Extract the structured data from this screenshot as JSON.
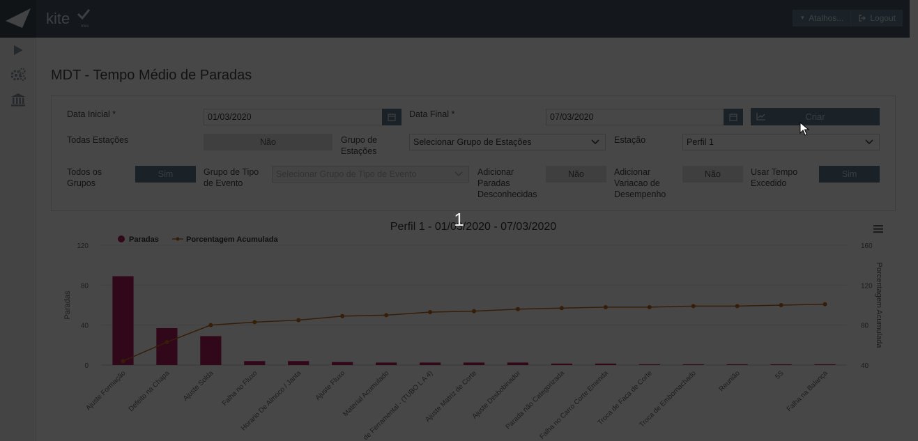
{
  "header": {
    "brand": "kite",
    "brand_sub": "mes",
    "shortcuts_label": "Atalhos...",
    "logout_label": "Logout"
  },
  "sidebar": {
    "items": [
      {
        "icon": "play-icon"
      },
      {
        "icon": "gears-icon"
      },
      {
        "icon": "bank-icon"
      }
    ]
  },
  "page": {
    "title": "MDT - Tempo Médio de Paradas"
  },
  "form": {
    "data_inicial_label": "Data Inicial *",
    "data_inicial_value": "01/03/2020",
    "data_final_label": "Data Final *",
    "data_final_value": "07/03/2020",
    "criar_label": "Criar",
    "todas_estacoes_label": "Todas Estações",
    "todas_estacoes_value": "Não",
    "grupo_estacoes_label": "Grupo de Estações",
    "grupo_estacoes_value": "Selecionar Grupo de Estações",
    "estacao_label": "Estação",
    "estacao_value": "Perfil 1",
    "todos_grupos_label": "Todos os Grupos",
    "todos_grupos_value": "Sim",
    "grupo_tipo_evento_label": "Grupo de Tipo de Evento",
    "grupo_tipo_evento_placeholder": "Selecionar Grupo de Tipo de Evento",
    "adicionar_paradas_label": "Adicionar Paradas Desconhecidas",
    "adicionar_paradas_value": "Não",
    "adicionar_variacao_label": "Adicionar Variacao de Desempenho",
    "adicionar_variacao_value": "Não",
    "usar_tempo_label": "Usar Tempo Excedido",
    "usar_tempo_value": "Sim"
  },
  "overlay": {
    "count": "1"
  },
  "colors": {
    "bar": "#b01e5c",
    "line": "#c26a1f",
    "accent": "#5d7a8c"
  },
  "chart_data": {
    "type": "bar",
    "title": "Perfil 1 - 01/03/2020 - 07/03/2020",
    "legend_position": "top-left",
    "categories": [
      "Ajuste Formação",
      "Defeito na Chapa",
      "Ajuste Solda",
      "Falha no Fluxo",
      "Horario De Almoco / Janta",
      "Ajuste Fluxo",
      "Material Acumulado",
      "de Ferramental - (TUBO L A 4)",
      "Ajuste Matriz de Corte",
      "Ajuste Desbobinador",
      "Parada não Categorizada",
      "Falha no Carro Corte Emenda",
      "Troca de Faca de Corte",
      "Troca de Embornachado",
      "Reunião",
      "5S",
      "Falha na Balança"
    ],
    "series": [
      {
        "name": "Paradas",
        "axis": "left",
        "values": [
          89,
          37,
          29,
          4,
          4,
          3,
          2.5,
          2.5,
          2.5,
          2.5,
          1.5,
          1.5,
          0.8,
          0.8,
          0.8,
          0.8,
          0.8
        ]
      },
      {
        "name": "Porcentagem Acumulada",
        "axis": "right",
        "type": "line",
        "values": [
          44,
          63,
          80,
          83,
          85,
          89,
          90,
          93,
          94,
          96,
          97,
          98,
          98,
          99,
          99,
          100,
          101
        ]
      }
    ],
    "ylabel": "Paradas",
    "y2label": "Porcentagem Acumulada",
    "ylim": [
      0,
      120
    ],
    "y_ticks": [
      0,
      40,
      80,
      120
    ],
    "y2lim": [
      40,
      160
    ],
    "y2_ticks": [
      40,
      80,
      120,
      160
    ],
    "grid": true
  }
}
